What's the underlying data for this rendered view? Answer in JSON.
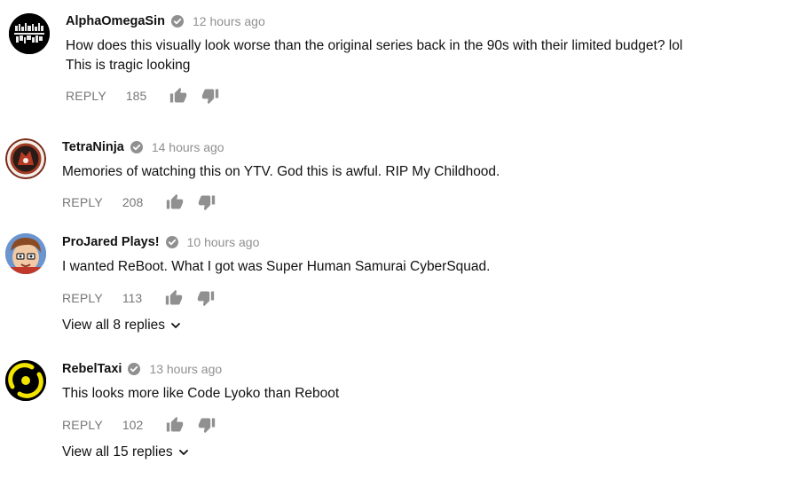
{
  "comments": [
    {
      "author": "AlphaOmegaSin",
      "time": "12 hours ago",
      "text_lines": [
        "How does this visually look worse than the original series back in the 90s with their limited budget? lol",
        "This is tragic looking"
      ],
      "reply_label": "REPLY",
      "likes": "185"
    },
    {
      "author": "TetraNinja",
      "time": "14 hours ago",
      "text_lines": [
        "Memories of watching this on YTV.  God this is awful. RIP My Childhood."
      ],
      "reply_label": "REPLY",
      "likes": "208"
    },
    {
      "author": "ProJared Plays!",
      "time": "10 hours ago",
      "text_lines": [
        "I wanted ReBoot. What I got was Super Human Samurai CyberSquad."
      ],
      "reply_label": "REPLY",
      "likes": "113",
      "view_replies": "View all 8 replies"
    },
    {
      "author": "RebelTaxi",
      "time": "13 hours ago",
      "text_lines": [
        "This looks more like Code Lyoko than Reboot"
      ],
      "reply_label": "REPLY",
      "likes": "102",
      "view_replies": "View all 15 replies"
    }
  ],
  "icons": {
    "verified": "verified-check-icon",
    "like": "thumb-up-icon",
    "dislike": "thumb-down-icon",
    "expand": "chevron-down-icon"
  },
  "colors": {
    "meta_gray": "#909090",
    "action_gray": "#777777",
    "text": "#111111"
  }
}
